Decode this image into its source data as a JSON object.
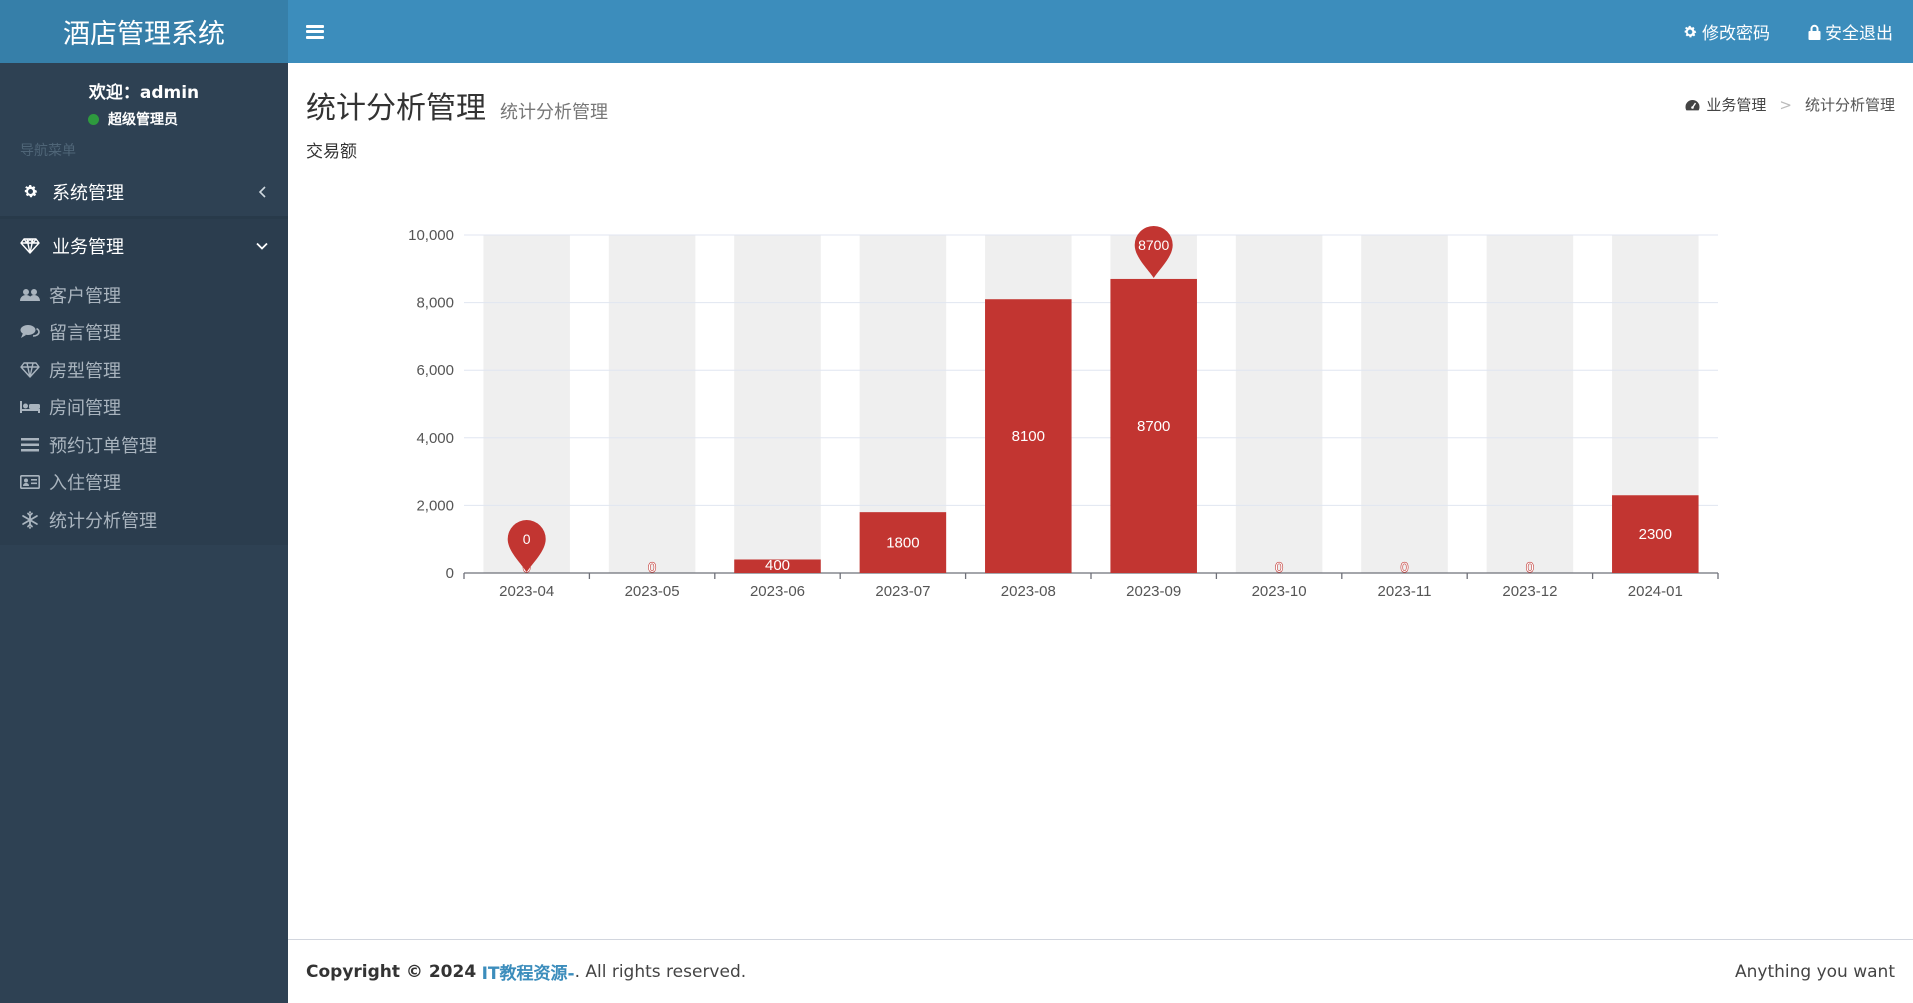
{
  "app": {
    "title": "酒店管理系统"
  },
  "header": {
    "change_password": "修改密码",
    "logout": "安全退出"
  },
  "user": {
    "welcome": "欢迎：admin",
    "role": "超级管理员"
  },
  "sidebar": {
    "nav_header": "导航菜单",
    "menus": [
      {
        "label": "系统管理",
        "icon": "gear-icon"
      },
      {
        "label": "业务管理",
        "icon": "diamond-icon"
      }
    ],
    "submenu": [
      {
        "label": "客户管理",
        "icon": "users-icon"
      },
      {
        "label": "留言管理",
        "icon": "comments-icon"
      },
      {
        "label": "房型管理",
        "icon": "diamond-icon"
      },
      {
        "label": "房间管理",
        "icon": "bed-icon"
      },
      {
        "label": "预约订单管理",
        "icon": "list-icon"
      },
      {
        "label": "入住管理",
        "icon": "id-card-icon"
      },
      {
        "label": "统计分析管理",
        "icon": "snowflake-icon"
      }
    ]
  },
  "page": {
    "title": "统计分析管理",
    "subtitle": "统计分析管理"
  },
  "breadcrumb": {
    "parent": "业务管理",
    "sep": ">",
    "current": "统计分析管理"
  },
  "chart_caption": "交易额",
  "chart_data": {
    "type": "bar",
    "categories": [
      "2023-04",
      "2023-05",
      "2023-06",
      "2023-07",
      "2023-08",
      "2023-09",
      "2023-10",
      "2023-11",
      "2023-12",
      "2024-01"
    ],
    "values": [
      0,
      0,
      400,
      1800,
      8100,
      8700,
      0,
      0,
      0,
      2300
    ],
    "ylim": [
      0,
      10000
    ],
    "yticks": [
      "0",
      "2,000",
      "4,000",
      "6,000",
      "8,000",
      "10,000"
    ],
    "max_marker": {
      "label": "8700",
      "category": "2023-09"
    },
    "min_marker": {
      "label": "0",
      "category": "2023-04"
    },
    "colors": {
      "bar": "#c23531",
      "background_bar": "#efefef",
      "axis_text": "#555555",
      "grid": "#e0e6f1"
    },
    "grid": true
  },
  "footer": {
    "copyright_prefix": "Copyright © 2024",
    "brand": "IT教程资源-",
    "suffix": ". All rights reserved.",
    "right": "Anything you want"
  }
}
